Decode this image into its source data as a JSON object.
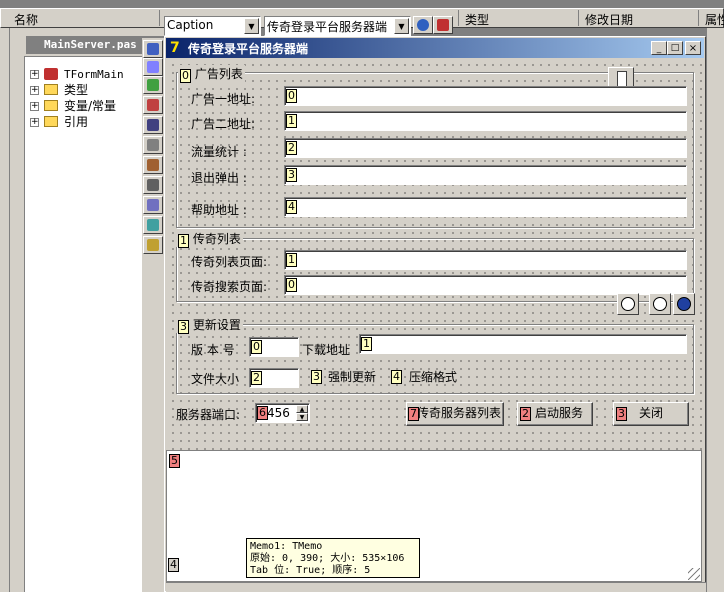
{
  "project": {
    "header_name": "名称",
    "tab_label": "MainServer.pas",
    "tree": [
      "TFormMain",
      "类型",
      "变量/常量",
      "引用"
    ]
  },
  "property_bar": {
    "property_name": "Caption",
    "property_value": "传奇登录平台服务器端"
  },
  "list_header": {
    "col_type": "类型",
    "col_date": "修改日期",
    "col_attr": "属性"
  },
  "form": {
    "title": "传奇登录平台服务器端",
    "ad_group": {
      "index": "0",
      "title": "广告列表",
      "fields": [
        {
          "label": "广告一地址:",
          "index": "0"
        },
        {
          "label": "广告二地址:",
          "index": "1"
        },
        {
          "label": "流量统计 :",
          "index": "2"
        },
        {
          "label": "退出弹出 :",
          "index": "3"
        },
        {
          "label": "帮助地址 :",
          "index": "4"
        }
      ]
    },
    "legend_group": {
      "index": "1",
      "title": "传奇列表",
      "fields": [
        {
          "label": "传奇列表页面:",
          "index": "1"
        },
        {
          "label": "传奇搜索页面:",
          "index": "0"
        }
      ]
    },
    "update_group": {
      "index": "3",
      "title": "更新设置",
      "version_label": "版 本 号",
      "version_index": "0",
      "download_label": "下载地址",
      "download_index": "1",
      "filesize_label": "文件大小",
      "filesize_index": "2",
      "force_index": "3",
      "force_label": "强制更新",
      "compress_index": "4",
      "compress_label": "压缩格式"
    },
    "port_label": "服务器端口:",
    "port_index": "6",
    "port_value": "456",
    "buttons": [
      {
        "index": "7",
        "label": "传奇服务器列表"
      },
      {
        "index": "2",
        "label": "启动服务"
      },
      {
        "index": "3",
        "label": "关闭"
      }
    ],
    "memo_index": "5",
    "bottom_index": "4"
  },
  "tooltip": {
    "line1": "Memo1: TMemo",
    "line2": "原始: 0, 390; 大小: 535×106",
    "line3": "Tab 位: True; 顺序: 5"
  }
}
